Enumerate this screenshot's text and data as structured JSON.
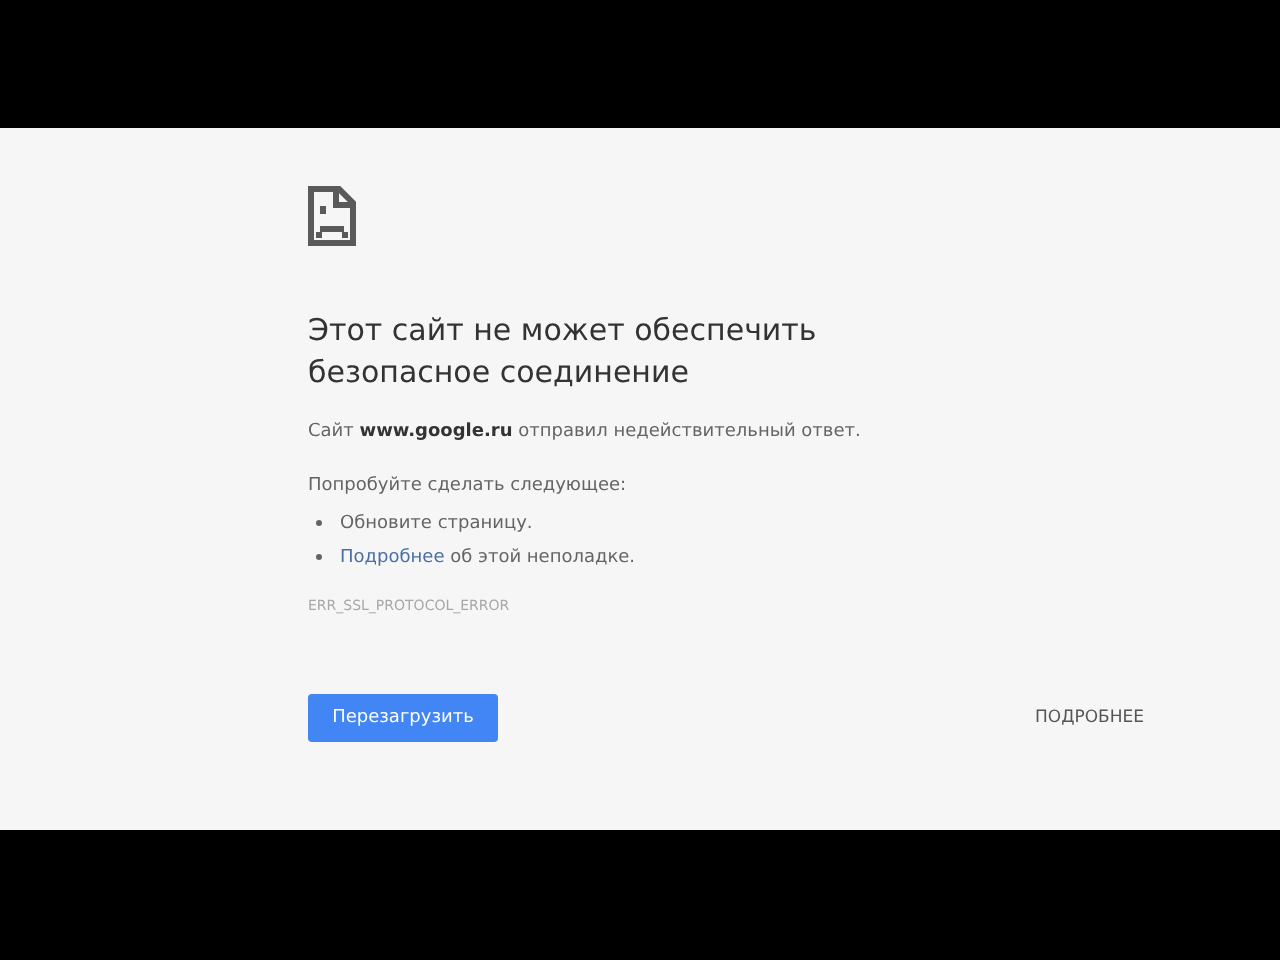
{
  "error_page": {
    "title": "Этот сайт не может обеспечить безопасное соединение",
    "message": "Сайт **www.google.ru** отправил недействительный ответ.",
    "suggestions_heading": "Попробуйте сделать следующее:",
    "suggestions": [
      {
        "kind": "text",
        "text": "Обновите страницу."
      },
      {
        "kind": "link",
        "link": "Подробнее",
        "text": "об этой неполадке."
      }
    ],
    "error_code": "ERR_SSL_PROTOCOL_ERROR",
    "reload_button": "Перезагрузить",
    "details_button": "ПОДРОБНЕЕ"
  }
}
